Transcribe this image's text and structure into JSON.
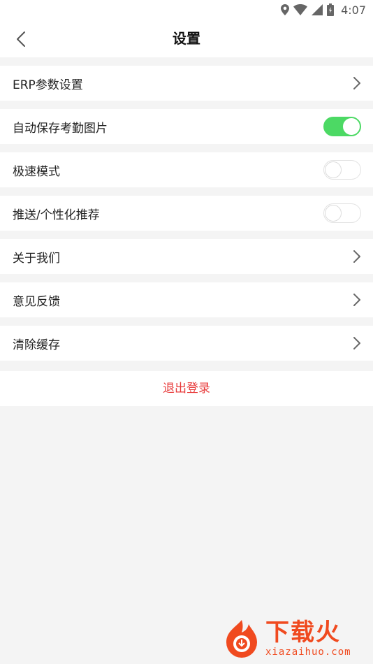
{
  "status_bar": {
    "time": "4:07",
    "icons": [
      "location-icon",
      "wifi-icon",
      "signal-icon",
      "battery-charging-icon"
    ]
  },
  "header": {
    "back_icon": "chevron-left-icon",
    "title": "设置"
  },
  "settings": [
    {
      "label": "ERP参数设置",
      "control": "chevron",
      "icon": "chevron-right-icon"
    },
    {
      "label": "自动保存考勤图片",
      "control": "toggle",
      "on": true
    },
    {
      "label": "极速模式",
      "control": "toggle",
      "on": false
    },
    {
      "label": "推送/个性化推荐",
      "control": "toggle",
      "on": false
    },
    {
      "label": "关于我们",
      "control": "chevron",
      "icon": "chevron-right-icon"
    },
    {
      "label": "意见反馈",
      "control": "chevron",
      "icon": "chevron-right-icon"
    },
    {
      "label": "清除缓存",
      "control": "chevron",
      "icon": "chevron-right-icon"
    }
  ],
  "logout": {
    "label": "退出登录"
  },
  "watermark": {
    "brand": "下载火",
    "domain": "xiazaihuo.com"
  },
  "colors": {
    "accent_red": "#e83b3b",
    "toggle_on": "#4cd964",
    "background": "#f4f4f4",
    "watermark": "#f04a1f"
  }
}
